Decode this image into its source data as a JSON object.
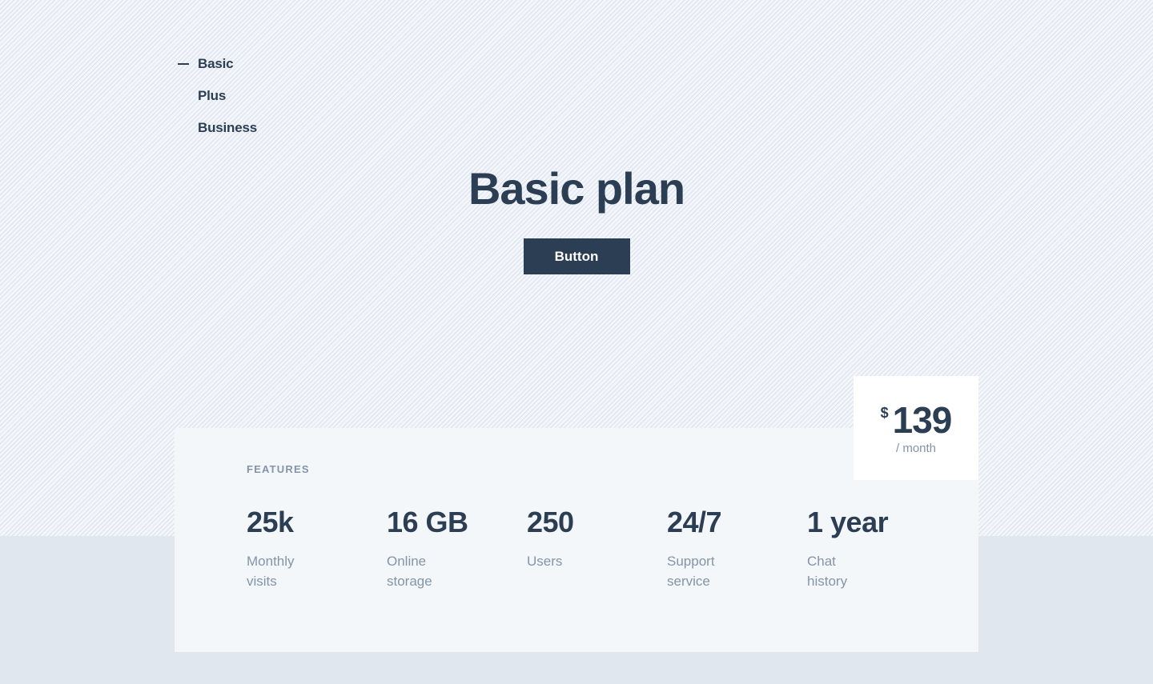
{
  "plan_nav": {
    "items": [
      {
        "label": "Basic",
        "active": true
      },
      {
        "label": "Plus",
        "active": false
      },
      {
        "label": "Business",
        "active": false
      }
    ]
  },
  "hero": {
    "title": "Basic plan",
    "button_label": "Button"
  },
  "price": {
    "currency": "$",
    "amount": "139",
    "period": "/ month"
  },
  "features": {
    "label": "FEATURES",
    "stats": [
      {
        "value": "25k",
        "label": "Monthly visits"
      },
      {
        "value": "16 GB",
        "label": "Online storage"
      },
      {
        "value": "250",
        "label": "Users"
      },
      {
        "value": "24/7",
        "label": "Support service"
      },
      {
        "value": "1 year",
        "label": "Chat history"
      }
    ]
  },
  "colors": {
    "primary": "#2c3e54",
    "muted": "#8494a8",
    "card_bg": "#f4f7fa",
    "page_bg": "#e1e7ef"
  }
}
